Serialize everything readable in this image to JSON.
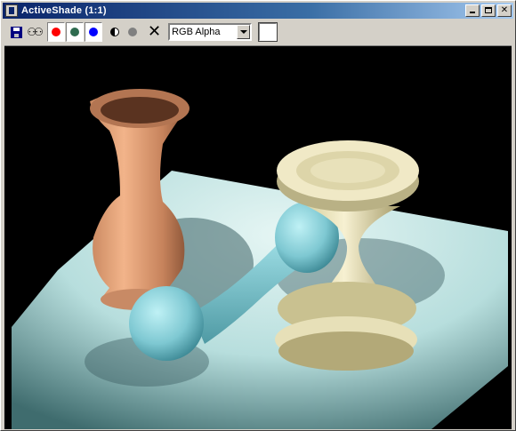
{
  "window": {
    "title": "ActiveShade (1:1)",
    "title_bar_color": "#0a246a"
  },
  "title_controls": {
    "minimize": "minimize",
    "maximize": "maximize",
    "close": "✕"
  },
  "toolbar": {
    "save_icon": "save-disk-icon",
    "clone_icon": "clone-render-icon",
    "clone_glyph": "⚇⚇",
    "channels": [
      {
        "name": "red",
        "color": "#ff0000"
      },
      {
        "name": "green",
        "color": "#2e6b4f"
      },
      {
        "name": "blue",
        "color": "#0000ff"
      }
    ],
    "monochrome_icon": "half-circle-icon",
    "alpha_icon": "gray-dot-icon",
    "clear_glyph": "✕",
    "display_mode": "RGB Alpha",
    "background_swatch_color": "#ffffff"
  },
  "render": {
    "scene": "3D rendered scene: terracotta vase, light blue dumbbell, cream hourglass on a pale plane",
    "background_color": "#000000"
  }
}
